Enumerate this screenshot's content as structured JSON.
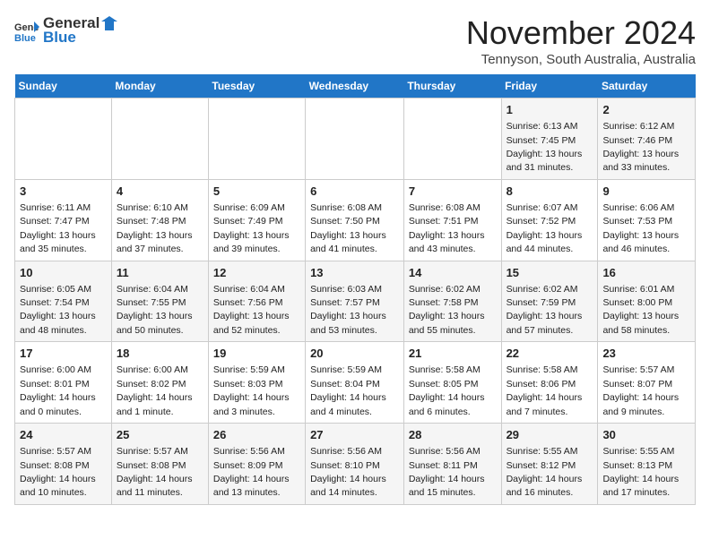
{
  "header": {
    "logo_general": "General",
    "logo_blue": "Blue",
    "month_title": "November 2024",
    "location": "Tennyson, South Australia, Australia"
  },
  "weekdays": [
    "Sunday",
    "Monday",
    "Tuesday",
    "Wednesday",
    "Thursday",
    "Friday",
    "Saturday"
  ],
  "weeks": [
    [
      {
        "day": "",
        "info": ""
      },
      {
        "day": "",
        "info": ""
      },
      {
        "day": "",
        "info": ""
      },
      {
        "day": "",
        "info": ""
      },
      {
        "day": "",
        "info": ""
      },
      {
        "day": "1",
        "info": "Sunrise: 6:13 AM\nSunset: 7:45 PM\nDaylight: 13 hours and 31 minutes."
      },
      {
        "day": "2",
        "info": "Sunrise: 6:12 AM\nSunset: 7:46 PM\nDaylight: 13 hours and 33 minutes."
      }
    ],
    [
      {
        "day": "3",
        "info": "Sunrise: 6:11 AM\nSunset: 7:47 PM\nDaylight: 13 hours and 35 minutes."
      },
      {
        "day": "4",
        "info": "Sunrise: 6:10 AM\nSunset: 7:48 PM\nDaylight: 13 hours and 37 minutes."
      },
      {
        "day": "5",
        "info": "Sunrise: 6:09 AM\nSunset: 7:49 PM\nDaylight: 13 hours and 39 minutes."
      },
      {
        "day": "6",
        "info": "Sunrise: 6:08 AM\nSunset: 7:50 PM\nDaylight: 13 hours and 41 minutes."
      },
      {
        "day": "7",
        "info": "Sunrise: 6:08 AM\nSunset: 7:51 PM\nDaylight: 13 hours and 43 minutes."
      },
      {
        "day": "8",
        "info": "Sunrise: 6:07 AM\nSunset: 7:52 PM\nDaylight: 13 hours and 44 minutes."
      },
      {
        "day": "9",
        "info": "Sunrise: 6:06 AM\nSunset: 7:53 PM\nDaylight: 13 hours and 46 minutes."
      }
    ],
    [
      {
        "day": "10",
        "info": "Sunrise: 6:05 AM\nSunset: 7:54 PM\nDaylight: 13 hours and 48 minutes."
      },
      {
        "day": "11",
        "info": "Sunrise: 6:04 AM\nSunset: 7:55 PM\nDaylight: 13 hours and 50 minutes."
      },
      {
        "day": "12",
        "info": "Sunrise: 6:04 AM\nSunset: 7:56 PM\nDaylight: 13 hours and 52 minutes."
      },
      {
        "day": "13",
        "info": "Sunrise: 6:03 AM\nSunset: 7:57 PM\nDaylight: 13 hours and 53 minutes."
      },
      {
        "day": "14",
        "info": "Sunrise: 6:02 AM\nSunset: 7:58 PM\nDaylight: 13 hours and 55 minutes."
      },
      {
        "day": "15",
        "info": "Sunrise: 6:02 AM\nSunset: 7:59 PM\nDaylight: 13 hours and 57 minutes."
      },
      {
        "day": "16",
        "info": "Sunrise: 6:01 AM\nSunset: 8:00 PM\nDaylight: 13 hours and 58 minutes."
      }
    ],
    [
      {
        "day": "17",
        "info": "Sunrise: 6:00 AM\nSunset: 8:01 PM\nDaylight: 14 hours and 0 minutes."
      },
      {
        "day": "18",
        "info": "Sunrise: 6:00 AM\nSunset: 8:02 PM\nDaylight: 14 hours and 1 minute."
      },
      {
        "day": "19",
        "info": "Sunrise: 5:59 AM\nSunset: 8:03 PM\nDaylight: 14 hours and 3 minutes."
      },
      {
        "day": "20",
        "info": "Sunrise: 5:59 AM\nSunset: 8:04 PM\nDaylight: 14 hours and 4 minutes."
      },
      {
        "day": "21",
        "info": "Sunrise: 5:58 AM\nSunset: 8:05 PM\nDaylight: 14 hours and 6 minutes."
      },
      {
        "day": "22",
        "info": "Sunrise: 5:58 AM\nSunset: 8:06 PM\nDaylight: 14 hours and 7 minutes."
      },
      {
        "day": "23",
        "info": "Sunrise: 5:57 AM\nSunset: 8:07 PM\nDaylight: 14 hours and 9 minutes."
      }
    ],
    [
      {
        "day": "24",
        "info": "Sunrise: 5:57 AM\nSunset: 8:08 PM\nDaylight: 14 hours and 10 minutes."
      },
      {
        "day": "25",
        "info": "Sunrise: 5:57 AM\nSunset: 8:08 PM\nDaylight: 14 hours and 11 minutes."
      },
      {
        "day": "26",
        "info": "Sunrise: 5:56 AM\nSunset: 8:09 PM\nDaylight: 14 hours and 13 minutes."
      },
      {
        "day": "27",
        "info": "Sunrise: 5:56 AM\nSunset: 8:10 PM\nDaylight: 14 hours and 14 minutes."
      },
      {
        "day": "28",
        "info": "Sunrise: 5:56 AM\nSunset: 8:11 PM\nDaylight: 14 hours and 15 minutes."
      },
      {
        "day": "29",
        "info": "Sunrise: 5:55 AM\nSunset: 8:12 PM\nDaylight: 14 hours and 16 minutes."
      },
      {
        "day": "30",
        "info": "Sunrise: 5:55 AM\nSunset: 8:13 PM\nDaylight: 14 hours and 17 minutes."
      }
    ]
  ]
}
